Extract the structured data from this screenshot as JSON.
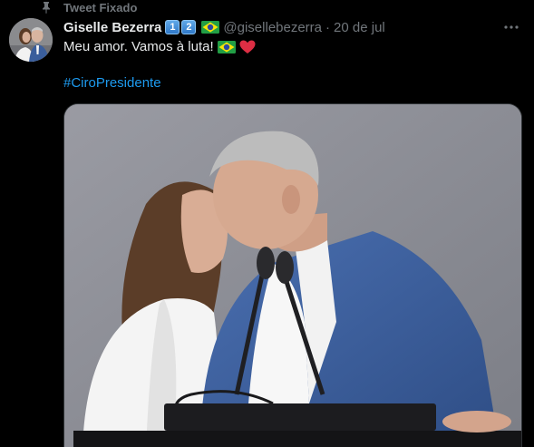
{
  "pinned": {
    "label": "Tweet Fixado",
    "icon": "pin-icon"
  },
  "author": {
    "display_name": "Giselle Bezerra",
    "badges": [
      "1",
      "2"
    ],
    "flag_icon": "brazil-flag-icon",
    "handle": "@gisellebezerra",
    "separator": "·",
    "date": "20 de jul"
  },
  "tweet": {
    "text": "Meu amor. Vamos à luta!",
    "emojis": [
      "brazil-flag-icon",
      "red-heart-icon"
    ],
    "hashtag": "#CiroPresidente"
  },
  "media": {
    "type": "photo",
    "description_icon": "photo-image"
  },
  "colors": {
    "background": "#000000",
    "primary_text": "#e7e9ea",
    "secondary_text": "#71767b",
    "link": "#1d9bf0",
    "heart": "#f91880",
    "border": "#2f3336"
  }
}
